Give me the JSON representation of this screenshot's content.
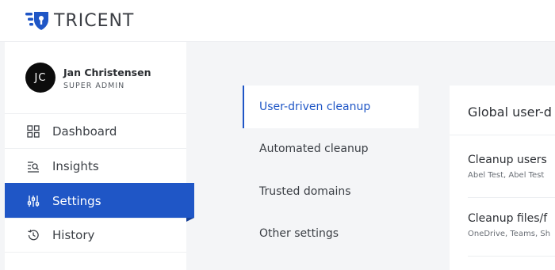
{
  "brand": {
    "name": "TRICENT",
    "logo_color": "#1f56c6"
  },
  "user": {
    "initials": "JC",
    "name": "Jan Christensen",
    "role": "SUPER ADMIN"
  },
  "sidebar": {
    "items": [
      {
        "label": "Dashboard",
        "icon": "dashboard-grid-icon"
      },
      {
        "label": "Insights",
        "icon": "insights-search-icon"
      },
      {
        "label": "Settings",
        "icon": "settings-sliders-icon",
        "active": true
      },
      {
        "label": "History",
        "icon": "history-clock-icon"
      }
    ]
  },
  "settings_nav": {
    "items": [
      {
        "label": "User-driven cleanup",
        "active": true
      },
      {
        "label": "Automated cleanup"
      },
      {
        "label": "Trusted domains"
      },
      {
        "label": "Other settings"
      }
    ]
  },
  "panel": {
    "title": "Global user-d",
    "rows": [
      {
        "title": "Cleanup users",
        "subtitle": "Abel Test, Abel Test"
      },
      {
        "title": "Cleanup files/f",
        "subtitle": "OneDrive, Teams, Sh"
      }
    ]
  },
  "colors": {
    "accent": "#1f56c6",
    "background": "#f4f5f7"
  }
}
